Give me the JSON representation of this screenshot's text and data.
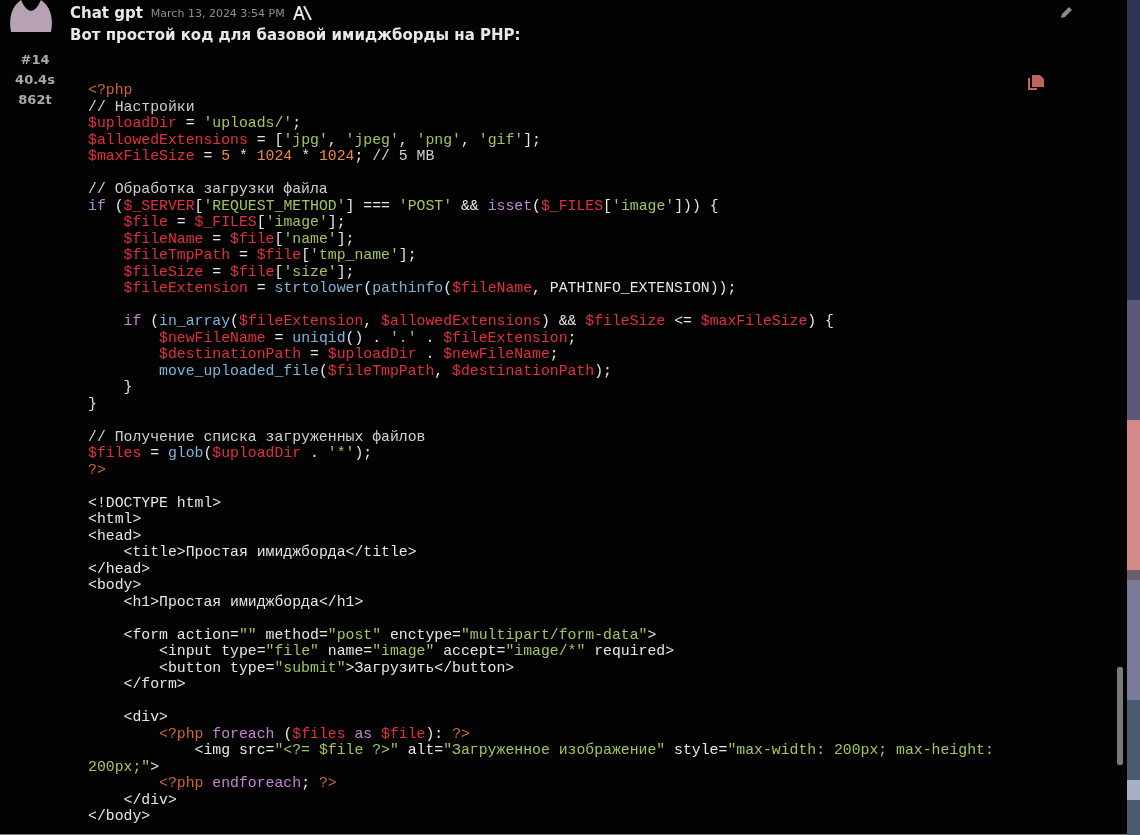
{
  "message": {
    "author": "Chat gpt",
    "timestamp": "March 13, 2024 3:54 PM",
    "index": "#14",
    "duration": "40.4s",
    "tokens": "862t",
    "text": "Вот простой код для базовой имиджборды на PHP:",
    "code_lines": [
      {
        "kind": "code",
        "tokens": [
          {
            "kind": "tag",
            "text": "<?php"
          }
        ]
      },
      {
        "kind": "code",
        "tokens": [
          {
            "kind": "comment",
            "text": "// Настройки"
          }
        ]
      },
      {
        "kind": "code",
        "tokens": [
          {
            "kind": "variable",
            "text": "$uploadDir"
          },
          {
            "kind": "plain",
            "text": " = "
          },
          {
            "kind": "string",
            "text": "'uploads/'"
          },
          {
            "kind": "plain",
            "text": ";"
          }
        ]
      },
      {
        "kind": "code",
        "tokens": [
          {
            "kind": "variable",
            "text": "$allowedExtensions"
          },
          {
            "kind": "plain",
            "text": " = ["
          },
          {
            "kind": "string",
            "text": "'jpg'"
          },
          {
            "kind": "plain",
            "text": ", "
          },
          {
            "kind": "string",
            "text": "'jpeg'"
          },
          {
            "kind": "plain",
            "text": ", "
          },
          {
            "kind": "string",
            "text": "'png'"
          },
          {
            "kind": "plain",
            "text": ", "
          },
          {
            "kind": "string",
            "text": "'gif'"
          },
          {
            "kind": "plain",
            "text": "];"
          }
        ]
      },
      {
        "kind": "code",
        "tokens": [
          {
            "kind": "variable",
            "text": "$maxFileSize"
          },
          {
            "kind": "plain",
            "text": " = "
          },
          {
            "kind": "number",
            "text": "5"
          },
          {
            "kind": "plain",
            "text": " * "
          },
          {
            "kind": "number",
            "text": "1024"
          },
          {
            "kind": "plain",
            "text": " * "
          },
          {
            "kind": "number",
            "text": "1024"
          },
          {
            "kind": "plain",
            "text": "; "
          },
          {
            "kind": "comment",
            "text": "// 5 MB"
          }
        ]
      },
      {
        "kind": "blank"
      },
      {
        "kind": "code",
        "tokens": [
          {
            "kind": "comment",
            "text": "// Обработка загрузки файла"
          }
        ]
      },
      {
        "kind": "code",
        "tokens": [
          {
            "kind": "keyword",
            "text": "if"
          },
          {
            "kind": "plain",
            "text": " ("
          },
          {
            "kind": "variable",
            "text": "$_SERVER"
          },
          {
            "kind": "plain",
            "text": "["
          },
          {
            "kind": "string",
            "text": "'REQUEST_METHOD'"
          },
          {
            "kind": "plain",
            "text": "] === "
          },
          {
            "kind": "string",
            "text": "'POST'"
          },
          {
            "kind": "plain",
            "text": " && "
          },
          {
            "kind": "keyword",
            "text": "isset"
          },
          {
            "kind": "plain",
            "text": "("
          },
          {
            "kind": "variable",
            "text": "$_FILES"
          },
          {
            "kind": "plain",
            "text": "["
          },
          {
            "kind": "string",
            "text": "'image'"
          },
          {
            "kind": "plain",
            "text": "])) {"
          }
        ]
      },
      {
        "kind": "code",
        "tokens": [
          {
            "kind": "variable",
            "text": "    $file"
          },
          {
            "kind": "plain",
            "text": " = "
          },
          {
            "kind": "variable",
            "text": "$_FILES"
          },
          {
            "kind": "plain",
            "text": "["
          },
          {
            "kind": "string",
            "text": "'image'"
          },
          {
            "kind": "plain",
            "text": "];"
          }
        ]
      },
      {
        "kind": "code",
        "tokens": [
          {
            "kind": "variable",
            "text": "    $fileName"
          },
          {
            "kind": "plain",
            "text": " = "
          },
          {
            "kind": "variable",
            "text": "$file"
          },
          {
            "kind": "plain",
            "text": "["
          },
          {
            "kind": "string",
            "text": "'name'"
          },
          {
            "kind": "plain",
            "text": "];"
          }
        ]
      },
      {
        "kind": "code",
        "tokens": [
          {
            "kind": "variable",
            "text": "    $fileTmpPath"
          },
          {
            "kind": "plain",
            "text": " = "
          },
          {
            "kind": "variable",
            "text": "$file"
          },
          {
            "kind": "plain",
            "text": "["
          },
          {
            "kind": "string",
            "text": "'tmp_name'"
          },
          {
            "kind": "plain",
            "text": "];"
          }
        ]
      },
      {
        "kind": "code",
        "tokens": [
          {
            "kind": "variable",
            "text": "    $fileSize"
          },
          {
            "kind": "plain",
            "text": " = "
          },
          {
            "kind": "variable",
            "text": "$file"
          },
          {
            "kind": "plain",
            "text": "["
          },
          {
            "kind": "string",
            "text": "'size'"
          },
          {
            "kind": "plain",
            "text": "];"
          }
        ]
      },
      {
        "kind": "code",
        "tokens": [
          {
            "kind": "variable",
            "text": "    $fileExtension"
          },
          {
            "kind": "plain",
            "text": " = "
          },
          {
            "kind": "function",
            "text": "strtolower"
          },
          {
            "kind": "plain",
            "text": "("
          },
          {
            "kind": "function",
            "text": "pathinfo"
          },
          {
            "kind": "plain",
            "text": "("
          },
          {
            "kind": "variable",
            "text": "$fileName"
          },
          {
            "kind": "plain",
            "text": ", PATHINFO_EXTENSION));"
          }
        ]
      },
      {
        "kind": "blank"
      },
      {
        "kind": "code",
        "tokens": [
          {
            "kind": "keyword",
            "text": "    if"
          },
          {
            "kind": "plain",
            "text": " ("
          },
          {
            "kind": "function",
            "text": "in_array"
          },
          {
            "kind": "plain",
            "text": "("
          },
          {
            "kind": "variable",
            "text": "$fileExtension"
          },
          {
            "kind": "plain",
            "text": ", "
          },
          {
            "kind": "variable",
            "text": "$allowedExtensions"
          },
          {
            "kind": "plain",
            "text": ") && "
          },
          {
            "kind": "variable",
            "text": "$fileSize"
          },
          {
            "kind": "plain",
            "text": " <= "
          },
          {
            "kind": "variable",
            "text": "$maxFileSize"
          },
          {
            "kind": "plain",
            "text": ") {"
          }
        ]
      },
      {
        "kind": "code",
        "tokens": [
          {
            "kind": "variable",
            "text": "        $newFileName"
          },
          {
            "kind": "plain",
            "text": " = "
          },
          {
            "kind": "function",
            "text": "uniqid"
          },
          {
            "kind": "plain",
            "text": "() . "
          },
          {
            "kind": "string",
            "text": "'.'"
          },
          {
            "kind": "plain",
            "text": " . "
          },
          {
            "kind": "variable",
            "text": "$fileExtension"
          },
          {
            "kind": "plain",
            "text": ";"
          }
        ]
      },
      {
        "kind": "code",
        "tokens": [
          {
            "kind": "variable",
            "text": "        $destinationPath"
          },
          {
            "kind": "plain",
            "text": " = "
          },
          {
            "kind": "variable",
            "text": "$uploadDir"
          },
          {
            "kind": "plain",
            "text": " . "
          },
          {
            "kind": "variable",
            "text": "$newFileName"
          },
          {
            "kind": "plain",
            "text": ";"
          }
        ]
      },
      {
        "kind": "code",
        "tokens": [
          {
            "kind": "function",
            "text": "        move_uploaded_file"
          },
          {
            "kind": "plain",
            "text": "("
          },
          {
            "kind": "variable",
            "text": "$fileTmpPath"
          },
          {
            "kind": "plain",
            "text": ", "
          },
          {
            "kind": "variable",
            "text": "$destinationPath"
          },
          {
            "kind": "plain",
            "text": ");"
          }
        ]
      },
      {
        "kind": "code",
        "tokens": [
          {
            "kind": "plain",
            "text": "    }"
          }
        ]
      },
      {
        "kind": "code",
        "tokens": [
          {
            "kind": "plain",
            "text": "}"
          }
        ]
      },
      {
        "kind": "blank"
      },
      {
        "kind": "code",
        "tokens": [
          {
            "kind": "comment",
            "text": "// Получение списка загруженных файлов"
          }
        ]
      },
      {
        "kind": "code",
        "tokens": [
          {
            "kind": "variable",
            "text": "$files"
          },
          {
            "kind": "plain",
            "text": " = "
          },
          {
            "kind": "function",
            "text": "glob"
          },
          {
            "kind": "plain",
            "text": "("
          },
          {
            "kind": "variable",
            "text": "$uploadDir"
          },
          {
            "kind": "plain",
            "text": " . "
          },
          {
            "kind": "string",
            "text": "'*'"
          },
          {
            "kind": "plain",
            "text": ");"
          }
        ]
      },
      {
        "kind": "code",
        "tokens": [
          {
            "kind": "tag",
            "text": "?>"
          }
        ]
      },
      {
        "kind": "blank"
      },
      {
        "kind": "code",
        "tokens": [
          {
            "kind": "plain",
            "text": "<!DOCTYPE html>"
          }
        ]
      },
      {
        "kind": "code",
        "tokens": [
          {
            "kind": "plain",
            "text": "<html>"
          }
        ]
      },
      {
        "kind": "code",
        "tokens": [
          {
            "kind": "plain",
            "text": "<head>"
          }
        ]
      },
      {
        "kind": "code",
        "tokens": [
          {
            "kind": "plain",
            "text": "    <title>Простая имиджборда</title>"
          }
        ]
      },
      {
        "kind": "code",
        "tokens": [
          {
            "kind": "plain",
            "text": "</head>"
          }
        ]
      },
      {
        "kind": "code",
        "tokens": [
          {
            "kind": "plain",
            "text": "<body>"
          }
        ]
      },
      {
        "kind": "code",
        "tokens": [
          {
            "kind": "plain",
            "text": "    <h1>Простая имиджборда</h1>"
          }
        ]
      },
      {
        "kind": "blank"
      },
      {
        "kind": "code",
        "tokens": [
          {
            "kind": "plain",
            "text": "    <form action="
          },
          {
            "kind": "string",
            "text": "\"\""
          },
          {
            "kind": "plain",
            "text": " method="
          },
          {
            "kind": "string",
            "text": "\"post\""
          },
          {
            "kind": "plain",
            "text": " enctype="
          },
          {
            "kind": "string",
            "text": "\"multipart/form-data\""
          },
          {
            "kind": "plain",
            "text": ">"
          }
        ]
      },
      {
        "kind": "code",
        "tokens": [
          {
            "kind": "plain",
            "text": "        <input type="
          },
          {
            "kind": "string",
            "text": "\"file\""
          },
          {
            "kind": "plain",
            "text": " name="
          },
          {
            "kind": "string",
            "text": "\"image\""
          },
          {
            "kind": "plain",
            "text": " accept="
          },
          {
            "kind": "string",
            "text": "\"image/*\""
          },
          {
            "kind": "plain",
            "text": " required>"
          }
        ]
      },
      {
        "kind": "code",
        "tokens": [
          {
            "kind": "plain",
            "text": "        <button type="
          },
          {
            "kind": "string",
            "text": "\"submit\""
          },
          {
            "kind": "plain",
            "text": ">Загрузить</button>"
          }
        ]
      },
      {
        "kind": "code",
        "tokens": [
          {
            "kind": "plain",
            "text": "    </form>"
          }
        ]
      },
      {
        "kind": "blank"
      },
      {
        "kind": "code",
        "tokens": [
          {
            "kind": "plain",
            "text": "    <div>"
          }
        ]
      },
      {
        "kind": "code",
        "tokens": [
          {
            "kind": "tag",
            "text": "        <?php"
          },
          {
            "kind": "keyword",
            "text": " foreach"
          },
          {
            "kind": "plain",
            "text": " ("
          },
          {
            "kind": "variable",
            "text": "$files"
          },
          {
            "kind": "keyword",
            "text": " as "
          },
          {
            "kind": "variable",
            "text": "$file"
          },
          {
            "kind": "plain",
            "text": "): "
          },
          {
            "kind": "tag",
            "text": "?>"
          }
        ]
      },
      {
        "kind": "code",
        "tokens": [
          {
            "kind": "plain",
            "text": "            <img src="
          },
          {
            "kind": "string",
            "text": "\"<?= $file ?>\""
          },
          {
            "kind": "plain",
            "text": " alt="
          },
          {
            "kind": "string",
            "text": "\"Загруженное изображение\""
          },
          {
            "kind": "plain",
            "text": " style="
          },
          {
            "kind": "string",
            "text": "\"max-width: 200px; max-height: 200px;\""
          },
          {
            "kind": "plain",
            "text": ">"
          }
        ]
      },
      {
        "kind": "code",
        "tokens": [
          {
            "kind": "tag",
            "text": "        <?php"
          },
          {
            "kind": "keyword",
            "text": " endforeach"
          },
          {
            "kind": "plain",
            "text": "; "
          },
          {
            "kind": "tag",
            "text": "?>"
          }
        ]
      },
      {
        "kind": "code",
        "tokens": [
          {
            "kind": "plain",
            "text": "    </div>"
          }
        ]
      },
      {
        "kind": "code",
        "tokens": [
          {
            "kind": "plain",
            "text": "</body>"
          }
        ]
      }
    ]
  }
}
